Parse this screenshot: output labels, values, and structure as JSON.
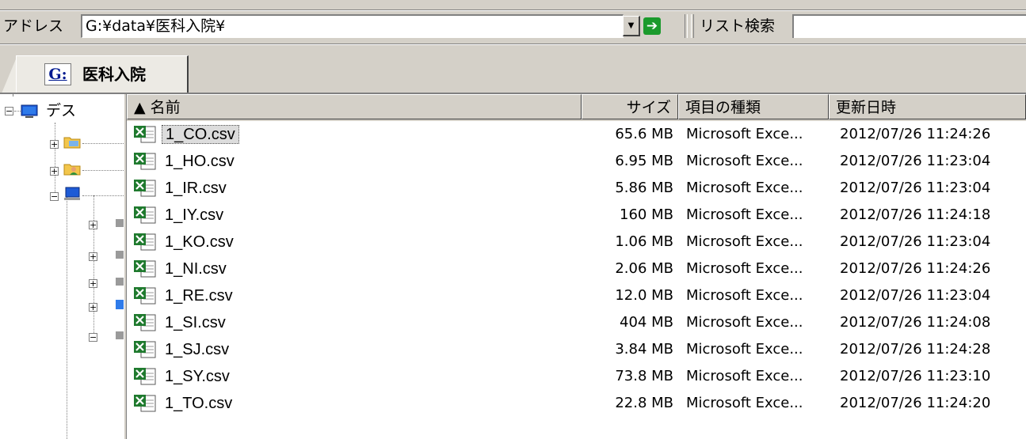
{
  "address_bar": {
    "label": "アドレス",
    "path": "G:¥data¥医科入院¥",
    "search_label": "リスト検索",
    "search_value": ""
  },
  "tab": {
    "drive_letter": "G:",
    "label": "医科入院"
  },
  "tree": {
    "root_label": "デス"
  },
  "list": {
    "columns": {
      "name": "▲ 名前",
      "size": "サイズ",
      "type": "項目の種類",
      "modified": "更新日時"
    },
    "files": [
      {
        "name": "1_CO.csv",
        "size": "65.6 MB",
        "type": "Microsoft Exce...",
        "modified": "2012/07/26 11:24:26"
      },
      {
        "name": "1_HO.csv",
        "size": "6.95 MB",
        "type": "Microsoft Exce...",
        "modified": "2012/07/26 11:23:04"
      },
      {
        "name": "1_IR.csv",
        "size": "5.86 MB",
        "type": "Microsoft Exce...",
        "modified": "2012/07/26 11:23:04"
      },
      {
        "name": "1_IY.csv",
        "size": "160 MB",
        "type": "Microsoft Exce...",
        "modified": "2012/07/26 11:24:18"
      },
      {
        "name": "1_KO.csv",
        "size": "1.06 MB",
        "type": "Microsoft Exce...",
        "modified": "2012/07/26 11:23:04"
      },
      {
        "name": "1_NI.csv",
        "size": "2.06 MB",
        "type": "Microsoft Exce...",
        "modified": "2012/07/26 11:24:26"
      },
      {
        "name": "1_RE.csv",
        "size": "12.0 MB",
        "type": "Microsoft Exce...",
        "modified": "2012/07/26 11:23:04"
      },
      {
        "name": "1_SI.csv",
        "size": "404 MB",
        "type": "Microsoft Exce...",
        "modified": "2012/07/26 11:24:08"
      },
      {
        "name": "1_SJ.csv",
        "size": "3.84 MB",
        "type": "Microsoft Exce...",
        "modified": "2012/07/26 11:24:28"
      },
      {
        "name": "1_SY.csv",
        "size": "73.8 MB",
        "type": "Microsoft Exce...",
        "modified": "2012/07/26 11:23:10"
      },
      {
        "name": "1_TO.csv",
        "size": "22.8 MB",
        "type": "Microsoft Exce...",
        "modified": "2012/07/26 11:24:20"
      }
    ],
    "selected_index": 0
  },
  "colors": {
    "window_face": "#d4d0c8",
    "excel_green": "#1f7a2e",
    "go_button": "#1b9a2c"
  }
}
